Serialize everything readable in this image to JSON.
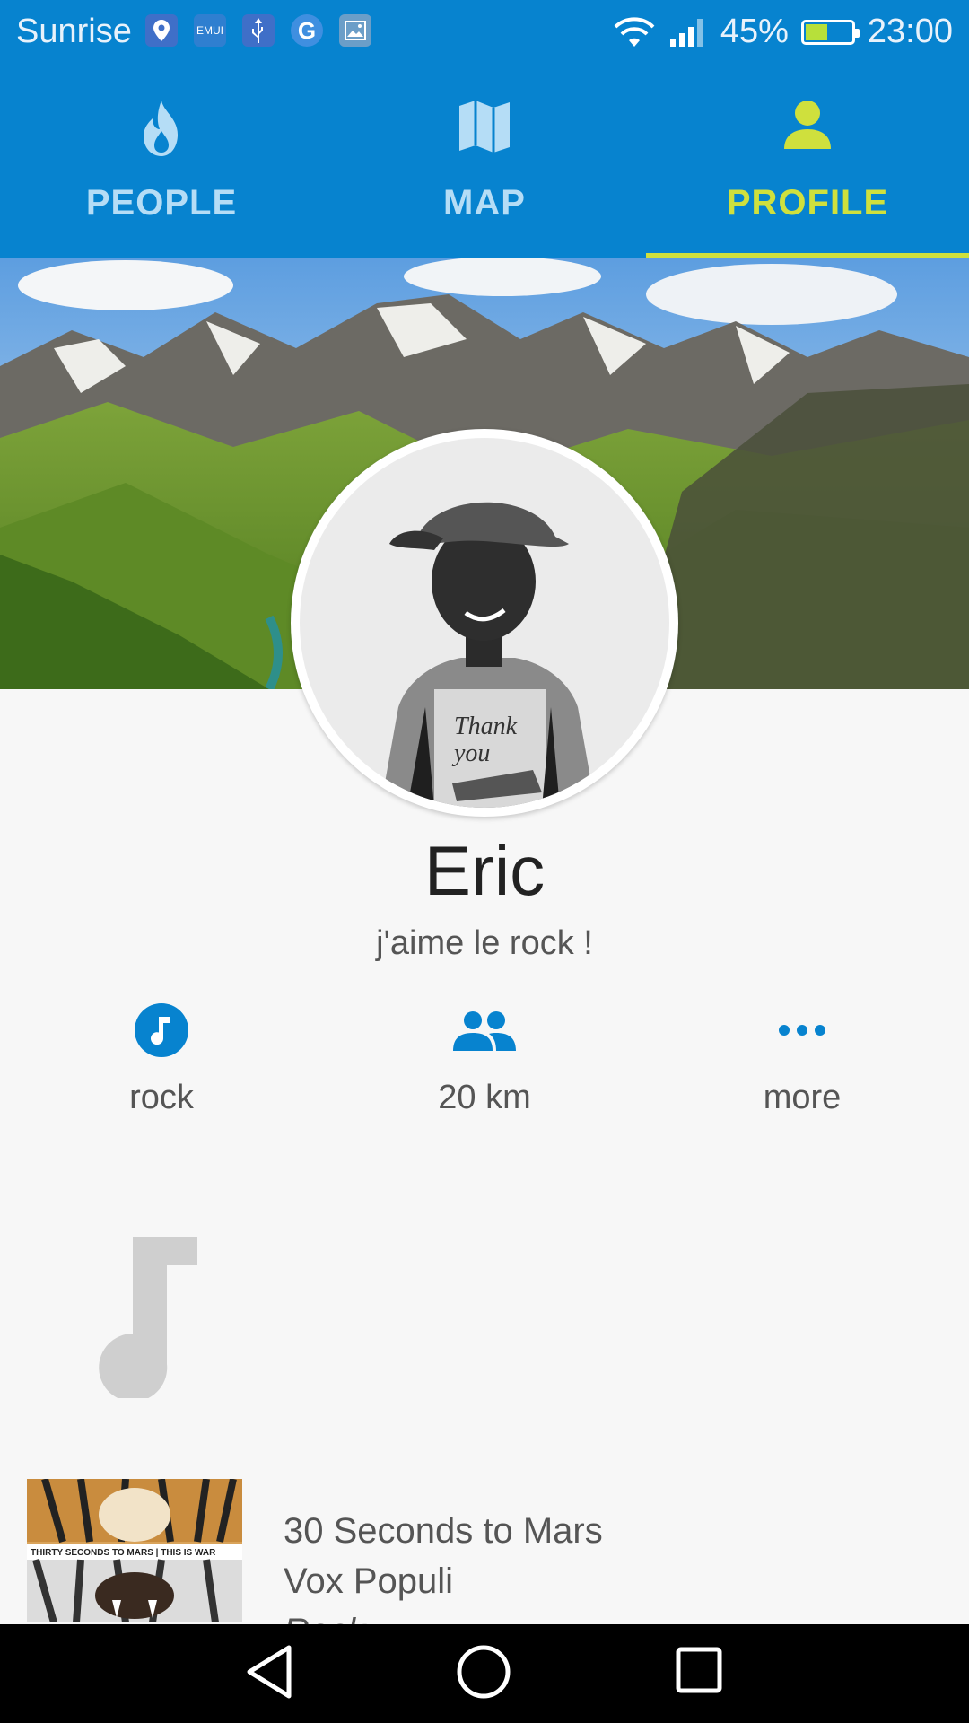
{
  "status_bar": {
    "carrier": "Sunrise",
    "battery": "45%",
    "time": "23:00",
    "notification_icons": [
      "location-pin-icon",
      "emui-icon",
      "usb-icon",
      "google-icon",
      "image-icon"
    ],
    "emui_label": "EMUI"
  },
  "tabs": [
    {
      "label": "PEOPLE",
      "icon": "flame-icon",
      "active": false
    },
    {
      "label": "MAP",
      "icon": "map-icon",
      "active": false
    },
    {
      "label": "PROFILE",
      "icon": "person-icon",
      "active": true
    }
  ],
  "profile": {
    "name": "Eric",
    "status": "j'aime le rock !",
    "shirt_text_1": "Thank",
    "shirt_text_2": "you"
  },
  "stats": [
    {
      "label": "rock",
      "icon": "music-note-circle-icon"
    },
    {
      "label": "20 km",
      "icon": "people-icon"
    },
    {
      "label": "more",
      "icon": "more-horiz-icon"
    }
  ],
  "track": {
    "artist": "30 Seconds to Mars",
    "title": "Vox Populi",
    "genre": "Rock",
    "album_banner": "THIRTY SECONDS TO MARS | THIS IS WAR"
  },
  "colors": {
    "primary": "#0783cf",
    "accent": "#cfe03d",
    "tab_inactive": "#b5ddf6",
    "icon_blue": "#0783cf"
  }
}
